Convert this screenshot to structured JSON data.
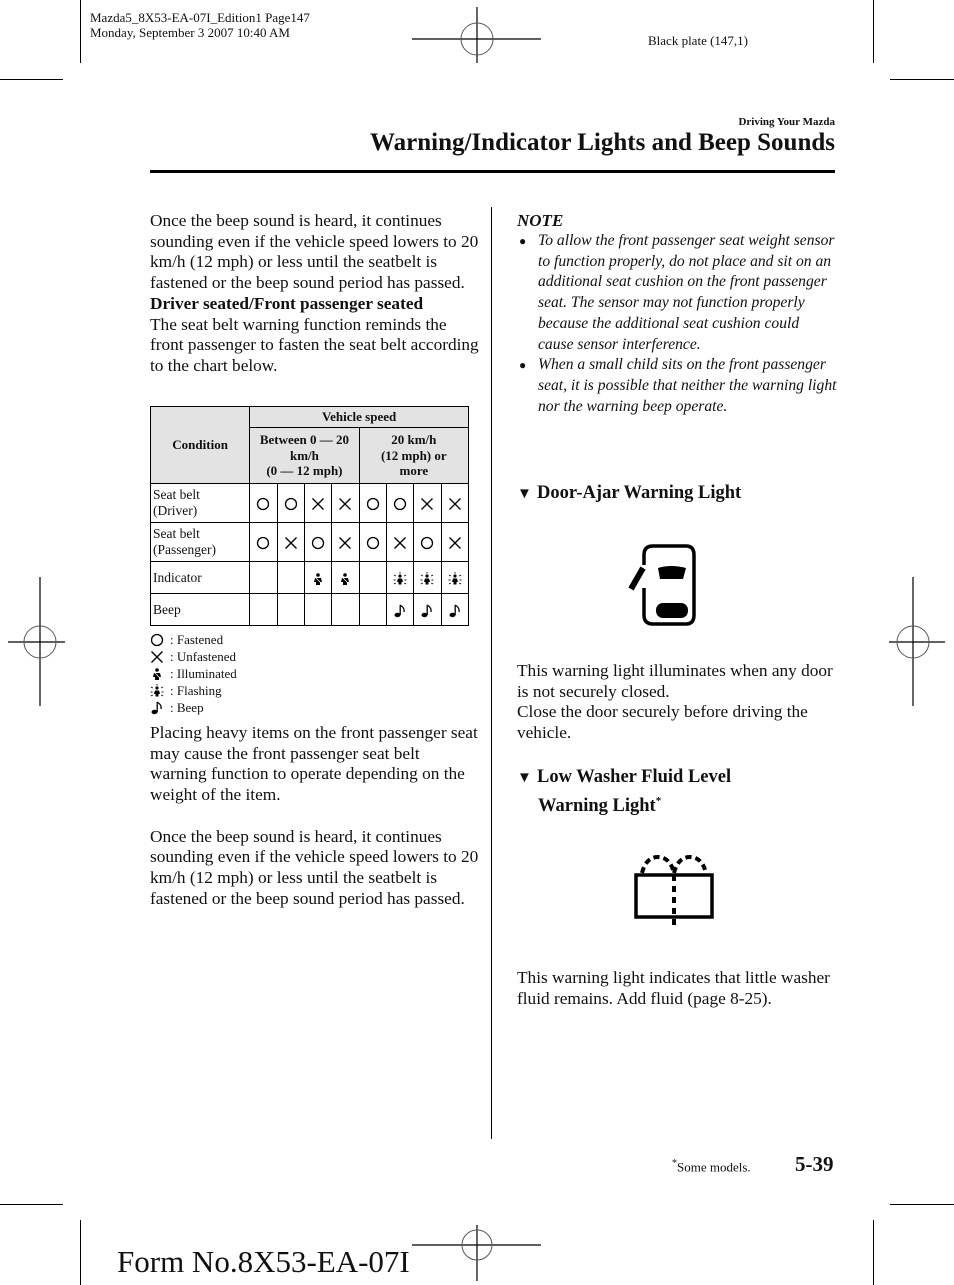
{
  "print_meta": {
    "file_line": "Mazda5_8X53-EA-07I_Edition1 Page147",
    "date_line": "Monday, September 3 2007 10:40 AM",
    "plate": "Black plate (147,1)"
  },
  "header": {
    "section": "Driving Your Mazda",
    "title": "Warning/Indicator Lights and Beep Sounds"
  },
  "left_column": {
    "para1": "Once the beep sound is heard, it continues sounding even if the vehicle speed lowers to 20 km/h (12 mph) or less until the seatbelt is fastened or the beep sound period has passed.",
    "subheading": "Driver seated/Front passenger seated",
    "para2": "The seat belt warning function reminds the front passenger to fasten the seat belt according to the chart below.",
    "table": {
      "condition_header": "Condition",
      "speed_header": "Vehicle speed",
      "speed_low": "Between 0 — 20 km/h (0 — 12 mph)",
      "speed_low_lines": [
        "Between 0 — 20",
        "km/h",
        "(0 — 12 mph)"
      ],
      "speed_high_lines": [
        "20 km/h",
        "(12 mph) or",
        "more"
      ],
      "rows": [
        {
          "label_lines": [
            "Seat belt",
            "(Driver)"
          ],
          "cells": [
            "fastened",
            "fastened",
            "unfastened",
            "unfastened",
            "fastened",
            "fastened",
            "unfastened",
            "unfastened"
          ]
        },
        {
          "label_lines": [
            "Seat belt",
            "(Passenger)"
          ],
          "cells": [
            "fastened",
            "unfastened",
            "fastened",
            "unfastened",
            "fastened",
            "unfastened",
            "fastened",
            "unfastened"
          ]
        },
        {
          "label_lines": [
            "Indicator"
          ],
          "cells": [
            "",
            "",
            "illuminated",
            "illuminated",
            "",
            "flashing",
            "flashing",
            "flashing"
          ]
        },
        {
          "label_lines": [
            "Beep"
          ],
          "cells": [
            "",
            "",
            "",
            "",
            "",
            "beep",
            "beep",
            "beep"
          ]
        }
      ]
    },
    "legend": [
      {
        "symbol": "fastened",
        "label": ": Fastened"
      },
      {
        "symbol": "unfastened",
        "label": ": Unfastened"
      },
      {
        "symbol": "illuminated",
        "label": ": Illuminated"
      },
      {
        "symbol": "flashing",
        "label": ": Flashing"
      },
      {
        "symbol": "beep",
        "label": ": Beep"
      }
    ],
    "para3": "Placing heavy items on the front passenger seat may cause the front passenger seat belt warning function to operate depending on the weight of the item.",
    "para4": "Once the beep sound is heard, it continues sounding even if the vehicle speed lowers to 20 km/h (12 mph) or less until the seatbelt is fastened or the beep sound period has passed."
  },
  "right_column": {
    "note_title": "NOTE",
    "notes": [
      "To allow the front passenger seat weight sensor to function properly, do not place and sit on an additional seat cushion on the front passenger seat. The sensor may not function properly because the additional seat cushion could cause sensor interference.",
      "When a small child sits on the front passenger seat, it is possible that neither the warning light nor the warning beep operate."
    ],
    "door_ajar": {
      "heading": "Door-Ajar Warning Light",
      "icon": "door-ajar-icon",
      "para1": "This warning light illuminates when any door is not securely closed.",
      "para2": "Close the door securely before driving the vehicle."
    },
    "washer": {
      "heading_line1": "Low Washer Fluid Level",
      "heading_line2": "Warning Light",
      "asterisk": "*",
      "icon": "washer-fluid-icon",
      "para": "This warning light indicates that little washer fluid remains. Add fluid (page 8-25)."
    }
  },
  "footer": {
    "footnote_mark": "*",
    "footnote": "Some models.",
    "page_number": "5-39",
    "form_number": "Form No.8X53-EA-07I"
  }
}
